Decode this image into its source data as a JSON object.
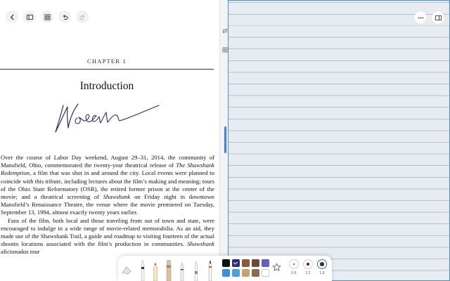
{
  "reader": {
    "chapter": "CHAPTER 1",
    "title": "Introduction",
    "paragraphs": [
      [
        {
          "t": "Over the course of Labor Day weekend, August 29–31, 2014, the community of Mansfield, Ohio, commemorated the twenty-year theatrical release of "
        },
        {
          "t": "The Shawshank Redemption",
          "i": true
        },
        {
          "t": ", a film that was shot in and around the city. Local events were planned to coincide with this tribute, including lectures about the film’s making and meaning; tours of the Ohio State Reformatory (OSR), the retired former prison at the center of the movie; and a theatrical screening of "
        },
        {
          "t": "Shawshank",
          "i": true
        },
        {
          "t": " on Friday night in downtown Mansfield’s Renaissance Theatre, the venue where the movie premiered on Tuesday, September 13, 1994, almost exactly twenty years earlier."
        }
      ],
      [
        {
          "t": "Fans of the film, both local and those traveling from out of town and state, were encouraged to indulge in a wide range of movie-related memorabilia. As an aid, they made use of the Shawshank Trail, a guide and roadmap to visiting fourteen of the actual shootin"
        },
        {
          "t": " locations"
        },
        {
          "t": " associated with the film’s production in"
        },
        {
          "t": " communities. "
        },
        {
          "t": "Shawshank",
          "i": true
        },
        {
          "t": " aficionados tour"
        }
      ]
    ]
  },
  "icons": {
    "back": "chevron-left-icon",
    "sidebar": "sidebar-icon",
    "grid": "grid-icon",
    "undo": "undo-icon",
    "redo": "redo-icon",
    "more": "more-icon",
    "split": "split-view-icon",
    "swap": "swap-icon",
    "page": "page-layout-icon",
    "favorite": "star-icon"
  },
  "pen_toolbar": {
    "tools": [
      "eraser",
      "fountain-pen",
      "pencil",
      "marker",
      "fineliner",
      "ballpoint",
      "brush"
    ],
    "colors": [
      "#111111",
      "#2d2b7a",
      "#8b5a3c",
      "#6b4a3a",
      "#6a5ac8",
      "#3a8ee6",
      "#4aa3d8",
      "#c8a070",
      "#8c6a50",
      "#ffffff"
    ],
    "selected_color": 1,
    "sizes": [
      "0.6",
      "1.2",
      "1.9"
    ],
    "selected_size": 2
  },
  "colors": {
    "accent": "#2a6fd6",
    "notebook_bg": "#e7ecf1",
    "ink": "#2d2b7a"
  }
}
